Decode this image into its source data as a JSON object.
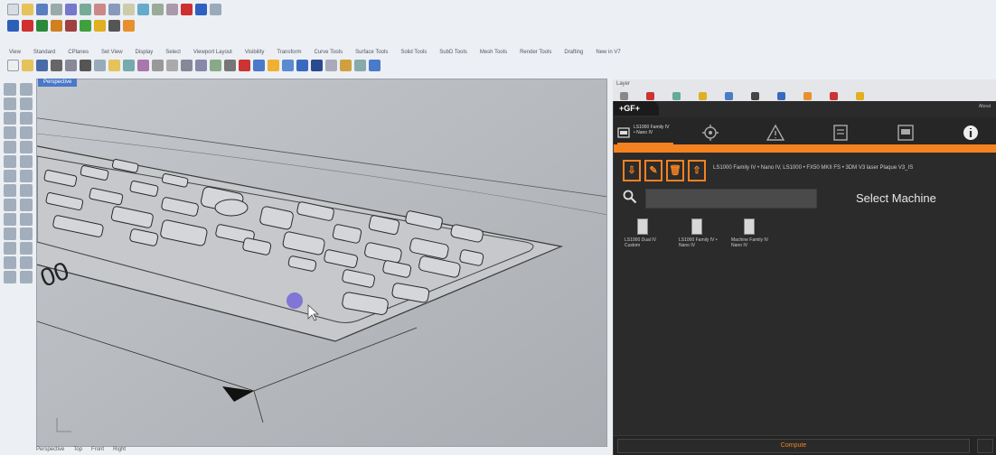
{
  "menu": [
    "View",
    "Standard",
    "CPlanes",
    "Set View",
    "Display",
    "Select",
    "Viewport Layout",
    "Visibility",
    "Transform",
    "Curve Tools",
    "Surface Tools",
    "Solid Tools",
    "SubD Tools",
    "Mesh Tools",
    "Render Tools",
    "Drafting",
    "New in V7"
  ],
  "viewport": {
    "tab_label": "Perspective",
    "dimension_text": "00"
  },
  "bottom_tabs": [
    "Perspective",
    "Top",
    "Front",
    "Right"
  ],
  "panel": {
    "header": "Layer",
    "logo": "+GF+",
    "about": "About",
    "active_tab_label": "LS1000 Family IV • Nano IV",
    "machine_path": "LS1000 Family IV • Nano IV, LS1000 • FX50 MKII FS • 3DM V3 laser Plaque V3_IS",
    "search": {
      "placeholder": "",
      "value": ""
    },
    "select_title": "Select Machine",
    "machines": [
      {
        "label": "LS1000 Dual IV Custom"
      },
      {
        "label": "LS1000 Family IV • Nano IV"
      },
      {
        "label": "Machine Family IV Nano IV"
      }
    ],
    "compute_label": "Compute"
  },
  "colors": {
    "accent": "#f58220",
    "panel_bg": "#2b2b2b",
    "viewport_bg": "#b9bcc0",
    "blue": "#4a78c8"
  },
  "icons": [
    "new-icon",
    "open-icon",
    "save-icon",
    "print-icon",
    "undo-icon",
    "redo-icon",
    "select-icon",
    "pan-icon",
    "rotate-icon",
    "zoom-icon",
    "properties-icon",
    "layer-icon",
    "search-icon",
    "info-icon",
    "settings-icon",
    "warning-icon",
    "delete-icon",
    "copy-icon",
    "grid-icon"
  ]
}
